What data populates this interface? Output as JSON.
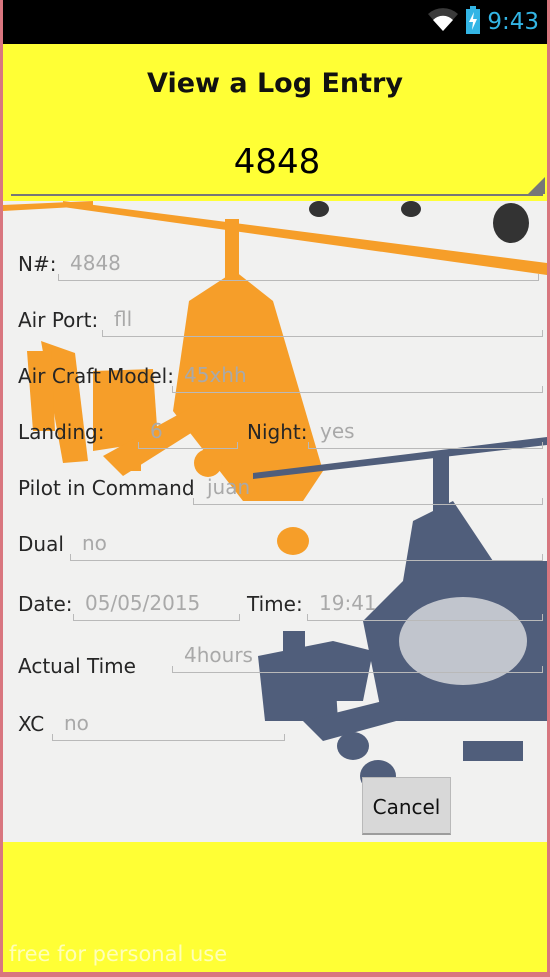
{
  "status_bar": {
    "time": "9:43",
    "icons": [
      "wifi-icon",
      "battery-charging-icon"
    ]
  },
  "header": {
    "title": "View a Log Entry"
  },
  "entry_selector": {
    "selected": "4848"
  },
  "form": {
    "number": {
      "label": "N#:",
      "value": "4848"
    },
    "airport": {
      "label": "Air Port:",
      "value": "fll"
    },
    "aircraft_model": {
      "label": "Air Craft Model:",
      "value": "45xhh"
    },
    "landing": {
      "label": "Landing:",
      "value": "6"
    },
    "night": {
      "label": "Night:",
      "value": "yes"
    },
    "pilot_in_command": {
      "label": "Pilot in Command",
      "value": "juan"
    },
    "dual": {
      "label": "Dual",
      "value": "no"
    },
    "date": {
      "label": "Date:",
      "value": "05/05/2015"
    },
    "time": {
      "label": "Time:",
      "value": "19:41"
    },
    "actual_time": {
      "label": "Actual Time",
      "value": "4hours"
    },
    "xc": {
      "label": "XC",
      "value": "no"
    }
  },
  "actions": {
    "cancel_label": "Cancel"
  },
  "watermark": "free for personal use",
  "colors": {
    "panel_yellow": "#ffff35",
    "orange": "#f7930e",
    "navy": "#3b4a6b",
    "status_blue": "#33b5e5"
  }
}
